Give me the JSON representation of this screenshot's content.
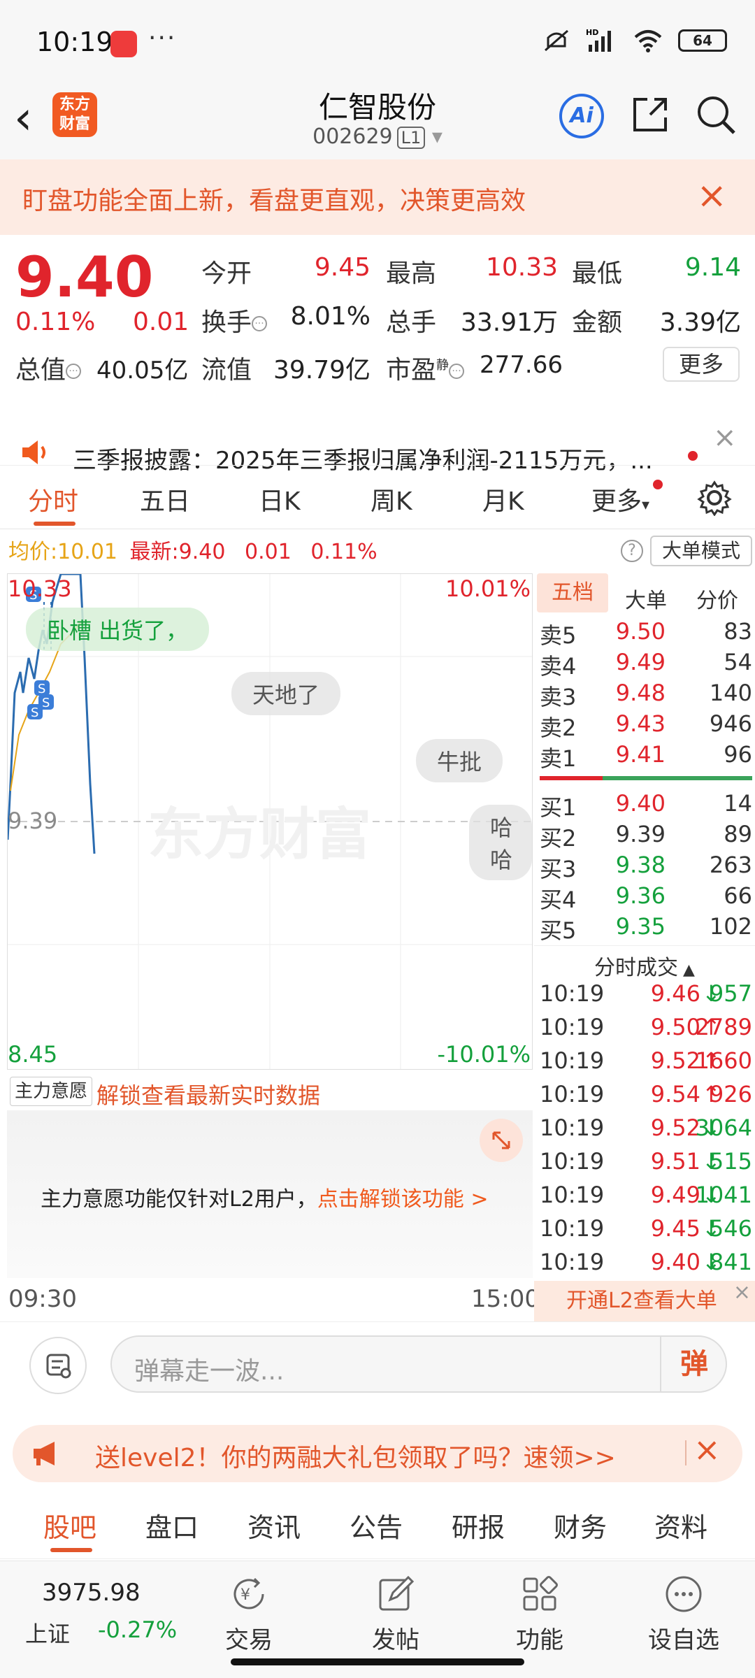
{
  "status": {
    "time": "10:19",
    "dots": "···",
    "battery": "64",
    "net": "HD"
  },
  "header": {
    "title": "仁智股份",
    "code": "002629",
    "level": "L1",
    "logo": "东方\n财富",
    "ai": "Ai"
  },
  "banner": {
    "text": "盯盘功能全面上新，看盘更直观，决策更高效"
  },
  "quote": {
    "price": "9.40",
    "pct": "0.11%",
    "chg": "0.01",
    "rows": [
      [
        {
          "l": "今开",
          "v": "9.45",
          "c": "red"
        },
        {
          "l": "最高",
          "v": "10.33",
          "c": "red"
        },
        {
          "l": "最低",
          "v": "9.14",
          "c": "green"
        }
      ],
      [
        {
          "l": "换手",
          "v": "8.01%",
          "c": "dark"
        },
        {
          "l": "总手",
          "v": "33.91万",
          "c": "dark"
        },
        {
          "l": "金额",
          "v": "3.39亿",
          "c": "dark"
        }
      ],
      [
        {
          "l": "流值",
          "v": "39.79亿",
          "c": "dark"
        },
        {
          "l": "市盈",
          "v": "277.66",
          "c": "dark"
        }
      ]
    ],
    "total_label": "总值",
    "total_value": "40.05亿",
    "pe_sup": "静",
    "more": "更多"
  },
  "notice": {
    "text": "三季报披露：2025年三季报归属净利润-2115万元，..."
  },
  "tabs": [
    "分时",
    "五日",
    "日K",
    "周K",
    "月K",
    "更多"
  ],
  "info": {
    "avg_label": "均价:",
    "avg": "10.01",
    "latest_label": "最新:",
    "latest": "9.40",
    "chg": "0.01",
    "pct": "0.11%",
    "bigmode": "大单模式"
  },
  "chart": {
    "top_price": "10.33",
    "top_pct": "10.01%",
    "mid_price": "9.39",
    "bot_price": "8.45",
    "bot_pct": "-10.01%",
    "watermark": "东方财富",
    "start_time": "09:30",
    "end_time": "15:00",
    "danmu": [
      "卧槽 出货了，",
      "天地了",
      "牛批",
      "哈哈"
    ],
    "colors": {
      "price_line": "#2b6cb0",
      "avg_line": "#e6a417"
    }
  },
  "orderbook": {
    "tabs": [
      "五档",
      "大单",
      "分价"
    ],
    "asks": [
      {
        "l": "卖5",
        "p": "9.50",
        "v": "83"
      },
      {
        "l": "卖4",
        "p": "9.49",
        "v": "54"
      },
      {
        "l": "卖3",
        "p": "9.48",
        "v": "140"
      },
      {
        "l": "卖2",
        "p": "9.43",
        "v": "946"
      },
      {
        "l": "卖1",
        "p": "9.41",
        "v": "96"
      }
    ],
    "bids": [
      {
        "l": "买1",
        "p": "9.40",
        "v": "14",
        "c": "red"
      },
      {
        "l": "买2",
        "p": "9.39",
        "v": "89",
        "c": "dark"
      },
      {
        "l": "买3",
        "p": "9.38",
        "v": "263",
        "c": "green"
      },
      {
        "l": "买4",
        "p": "9.36",
        "v": "66",
        "c": "green"
      },
      {
        "l": "买5",
        "p": "9.35",
        "v": "102",
        "c": "green"
      }
    ]
  },
  "trades": {
    "title": "分时成交",
    "rows": [
      {
        "t": "10:19",
        "p": "9.46",
        "d": "↓",
        "v": "957"
      },
      {
        "t": "10:19",
        "p": "9.50",
        "d": "↑",
        "v": "2789"
      },
      {
        "t": "10:19",
        "p": "9.52",
        "d": "↑",
        "v": "1660"
      },
      {
        "t": "10:19",
        "p": "9.54",
        "d": "↑",
        "v": "926"
      },
      {
        "t": "10:19",
        "p": "9.52",
        "d": "↓",
        "v": "3064"
      },
      {
        "t": "10:19",
        "p": "9.51",
        "d": "↓",
        "v": "515"
      },
      {
        "t": "10:19",
        "p": "9.49",
        "d": "↓",
        "v": "1041"
      },
      {
        "t": "10:19",
        "p": "9.45",
        "d": "↓",
        "v": "546"
      },
      {
        "t": "10:19",
        "p": "9.40",
        "d": "↓",
        "v": "841"
      }
    ],
    "l2": "开通L2查看大单"
  },
  "mainforce": {
    "select": "主力意愿",
    "unlock": "解锁查看最新实时数据",
    "desc": "主力意愿功能仅针对L2用户，",
    "link": "点击解锁该功能 >"
  },
  "comment": {
    "placeholder": "弹幕走一波...",
    "dan": "弹"
  },
  "promo": {
    "text": "送level2！你的两融大礼包领取了吗？速领>>"
  },
  "lower_tabs": [
    "股吧",
    "盘口",
    "资讯",
    "公告",
    "研报",
    "财务",
    "资料"
  ],
  "bottom_nav": {
    "index_value": "3975.98",
    "index_name": "上证",
    "index_pct": "-0.27%",
    "items": [
      "交易",
      "发帖",
      "功能",
      "设自选"
    ]
  }
}
